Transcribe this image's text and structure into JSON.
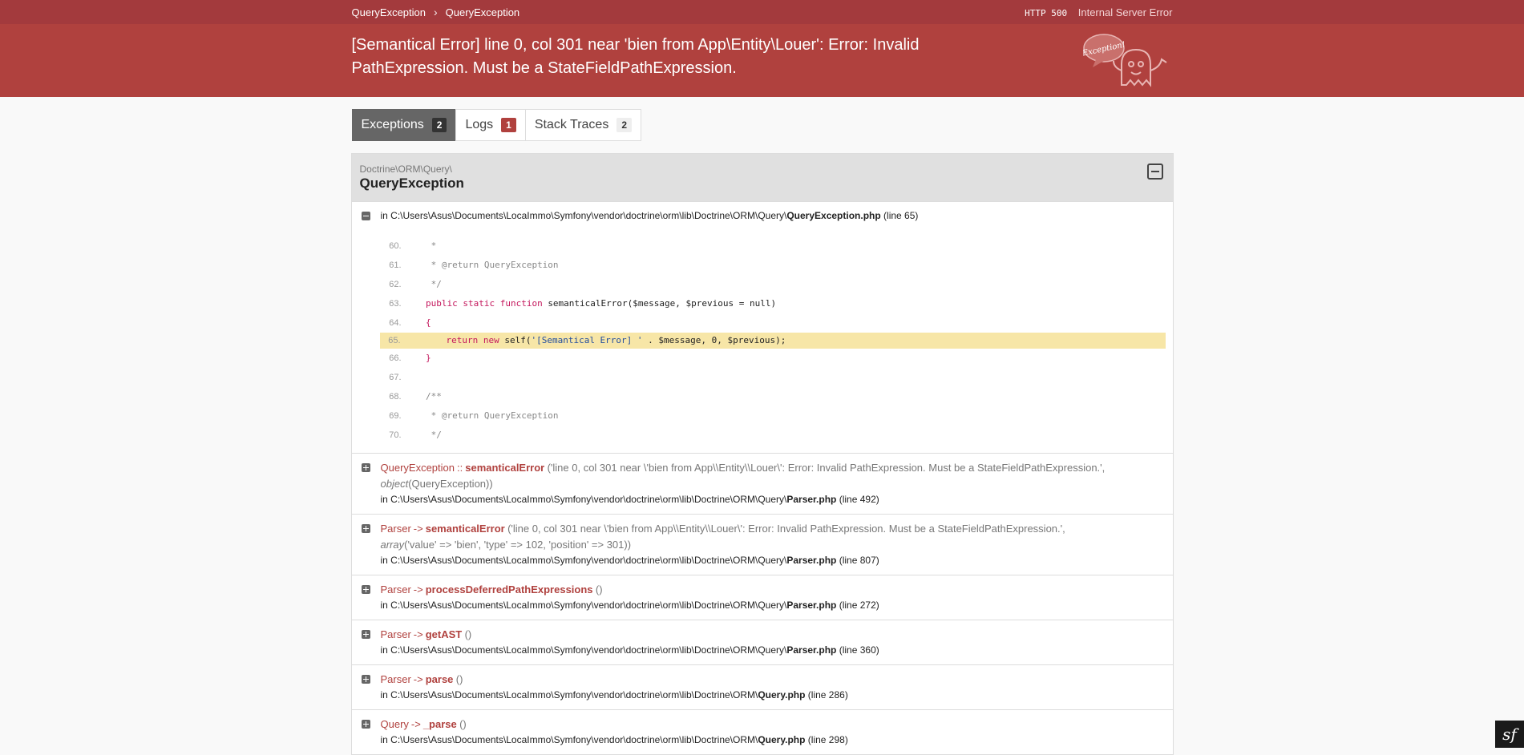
{
  "breadcrumb": {
    "items": [
      "QueryException",
      "QueryException"
    ]
  },
  "status": {
    "code": "HTTP 500",
    "text": "Internal Server Error"
  },
  "exception_message": "[Semantical Error] line 0, col 301 near 'bien from App\\Entity\\Louer': Error: Invalid PathExpression. Must be a StateFieldPathExpression.",
  "logo_text": "Exception!",
  "tabs": [
    {
      "label": "Exceptions",
      "count": "2"
    },
    {
      "label": "Logs",
      "count": "1"
    },
    {
      "label": "Stack Traces",
      "count": "2"
    }
  ],
  "exception": {
    "namespace": "Doctrine\\ORM\\Query\\",
    "class": "QueryException",
    "file": {
      "prefix": "in C:\\Users\\Asus\\Documents\\LocaImmo\\Symfony\\vendor\\doctrine\\orm\\lib\\Doctrine\\ORM\\Query\\",
      "name": "QueryException.php",
      "line": "(line 65)"
    }
  },
  "code_lines": [
    {
      "n": "60.",
      "t": "     *"
    },
    {
      "n": "61.",
      "t": "     * @return QueryException"
    },
    {
      "n": "62.",
      "t": "     */"
    },
    {
      "n": "63.",
      "t": "    public static function semanticalError($message, $previous = null)"
    },
    {
      "n": "64.",
      "t": "    {"
    },
    {
      "n": "65.",
      "t": "        return new self('[Semantical Error] ' . $message, 0, $previous);"
    },
    {
      "n": "66.",
      "t": "    }"
    },
    {
      "n": "67.",
      "t": ""
    },
    {
      "n": "68.",
      "t": "    /**"
    },
    {
      "n": "69.",
      "t": "     * @return QueryException"
    },
    {
      "n": "70.",
      "t": "     */"
    }
  ],
  "traces": [
    {
      "cls": "QueryException",
      "arrow": "::",
      "fn": "semanticalError",
      "args": "('line 0, col 301 near \\'bien from App\\\\Entity\\\\Louer\\': Error: Invalid PathExpression. Must be a StateFieldPathExpression.', ",
      "args_type": "object",
      "args_tail": "(QueryException))",
      "file_prefix": "in C:\\Users\\Asus\\Documents\\LocaImmo\\Symfony\\vendor\\doctrine\\orm\\lib\\Doctrine\\ORM\\Query\\",
      "file_name": "Parser.php",
      "line": "(line 492)"
    },
    {
      "cls": "Parser",
      "arrow": "->",
      "fn": "semanticalError",
      "args": "('line 0, col 301 near \\'bien from App\\\\Entity\\\\Louer\\': Error: Invalid PathExpression. Must be a StateFieldPathExpression.', ",
      "args_type": "array",
      "args_tail": "('value' => 'bien', 'type' => 102, 'position' => 301))",
      "file_prefix": "in C:\\Users\\Asus\\Documents\\LocaImmo\\Symfony\\vendor\\doctrine\\orm\\lib\\Doctrine\\ORM\\Query\\",
      "file_name": "Parser.php",
      "line": "(line 807)"
    },
    {
      "cls": "Parser",
      "arrow": "->",
      "fn": "processDeferredPathExpressions",
      "args": "()",
      "args_type": "",
      "args_tail": "",
      "file_prefix": "in C:\\Users\\Asus\\Documents\\LocaImmo\\Symfony\\vendor\\doctrine\\orm\\lib\\Doctrine\\ORM\\Query\\",
      "file_name": "Parser.php",
      "line": "(line 272)"
    },
    {
      "cls": "Parser",
      "arrow": "->",
      "fn": "getAST",
      "args": "()",
      "args_type": "",
      "args_tail": "",
      "file_prefix": "in C:\\Users\\Asus\\Documents\\LocaImmo\\Symfony\\vendor\\doctrine\\orm\\lib\\Doctrine\\ORM\\Query\\",
      "file_name": "Parser.php",
      "line": "(line 360)"
    },
    {
      "cls": "Parser",
      "arrow": "->",
      "fn": "parse",
      "args": "()",
      "args_type": "",
      "args_tail": "",
      "file_prefix": "in C:\\Users\\Asus\\Documents\\LocaImmo\\Symfony\\vendor\\doctrine\\orm\\lib\\Doctrine\\ORM\\",
      "file_name": "Query.php",
      "line": "(line 286)"
    },
    {
      "cls": "Query",
      "arrow": "->",
      "fn": "_parse",
      "args": "()",
      "args_type": "",
      "args_tail": "",
      "file_prefix": "in C:\\Users\\Asus\\Documents\\LocaImmo\\Symfony\\vendor\\doctrine\\orm\\lib\\Doctrine\\ORM\\",
      "file_name": "Query.php",
      "line": "(line 298)"
    }
  ],
  "toolbar_logo": "sf"
}
